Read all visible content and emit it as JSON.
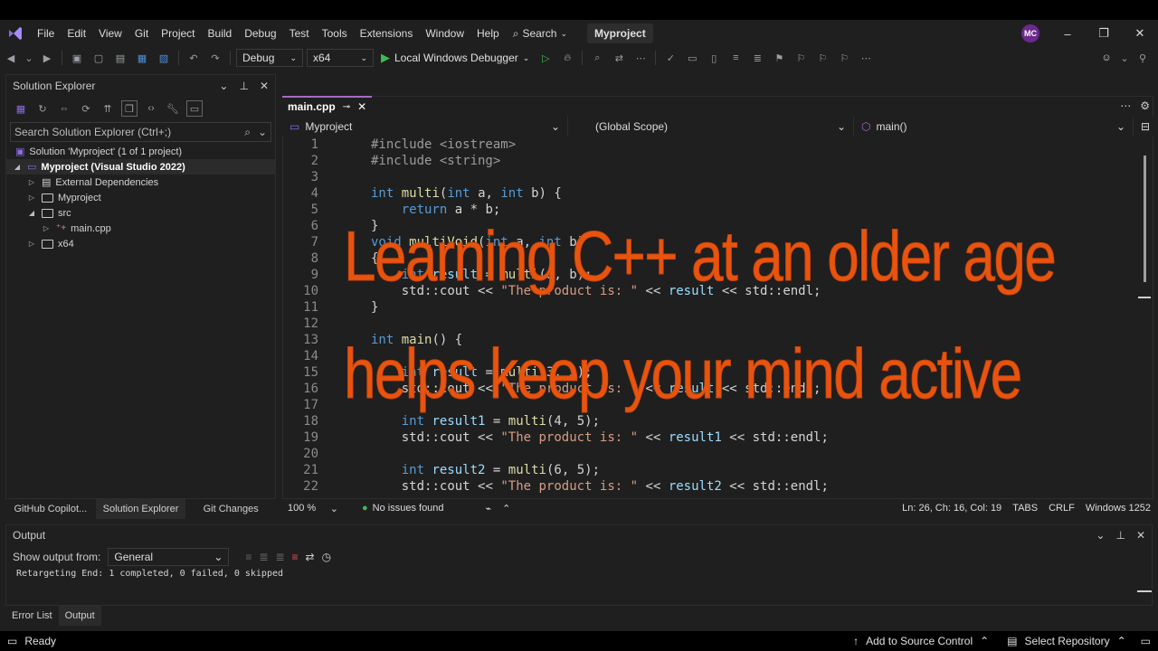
{
  "menubar": {
    "items": [
      "File",
      "Edit",
      "View",
      "Git",
      "Project",
      "Build",
      "Debug",
      "Test",
      "Tools",
      "Extensions",
      "Window",
      "Help"
    ],
    "search_label": "Search",
    "project_title": "Myproject",
    "avatar_initials": "MC"
  },
  "toolbar": {
    "config": "Debug",
    "platform": "x64",
    "debugger": "Local Windows Debugger"
  },
  "solution_explorer": {
    "title": "Solution Explorer",
    "search_placeholder": "Search Solution Explorer (Ctrl+;)",
    "tree": [
      {
        "label": "Solution 'Myproject' (1 of 1 project)"
      },
      {
        "label": "Myproject (Visual Studio 2022)"
      },
      {
        "label": "External Dependencies"
      },
      {
        "label": "Myproject"
      },
      {
        "label": "src"
      },
      {
        "label": "main.cpp"
      },
      {
        "label": "x64"
      }
    ],
    "tabs": [
      "GitHub Copilot...",
      "Solution Explorer",
      "Git Changes"
    ]
  },
  "editor": {
    "tab_label": "main.cpp",
    "nav": {
      "project": "Myproject",
      "scope": "(Global Scope)",
      "member": "main()"
    },
    "lines": [
      "    #include <iostream>",
      "    #include <string>",
      "",
      "    int multi(int a, int b) {",
      "        return a * b;",
      "    }",
      "    void multiVoid(int a, int b)",
      "    {",
      "        int result = multi(a, b);",
      "        std::cout << \"The product is: \" << result << std::endl;",
      "    }",
      "",
      "    int main() {",
      "",
      "        int result = multi(3, 5);",
      "        std::cout << \"The product is: \" << result << std::endl;",
      "",
      "        int result1 = multi(4, 5);",
      "        std::cout << \"The product is: \" << result1 << std::endl;",
      "",
      "        int result2 = multi(6, 5);",
      "        std::cout << \"The product is: \" << result2 << std::endl;"
    ],
    "zoom": "100 %",
    "issues": "No issues found",
    "position": "Ln: 26, Ch: 16, Col: 19",
    "indent": "TABS",
    "line_ending": "CRLF",
    "encoding": "Windows 1252"
  },
  "output": {
    "title": "Output",
    "show_from_label": "Show output from:",
    "source": "General",
    "text": "Retargeting End: 1 completed, 0 failed, 0 skipped"
  },
  "bottom_tabs": [
    "Error List",
    "Output"
  ],
  "statusbar": {
    "ready": "Ready",
    "source_control": "Add to Source Control",
    "repository": "Select Repository"
  },
  "overlay": {
    "line1": "Learning C++ at an older age",
    "line2": "helps keep your mind active"
  },
  "colors": {
    "accent": "#a56cc1",
    "overlay_text": "#e8540f",
    "keyword": "#569cd6",
    "function": "#dcdcaa",
    "string": "#d69d85"
  }
}
